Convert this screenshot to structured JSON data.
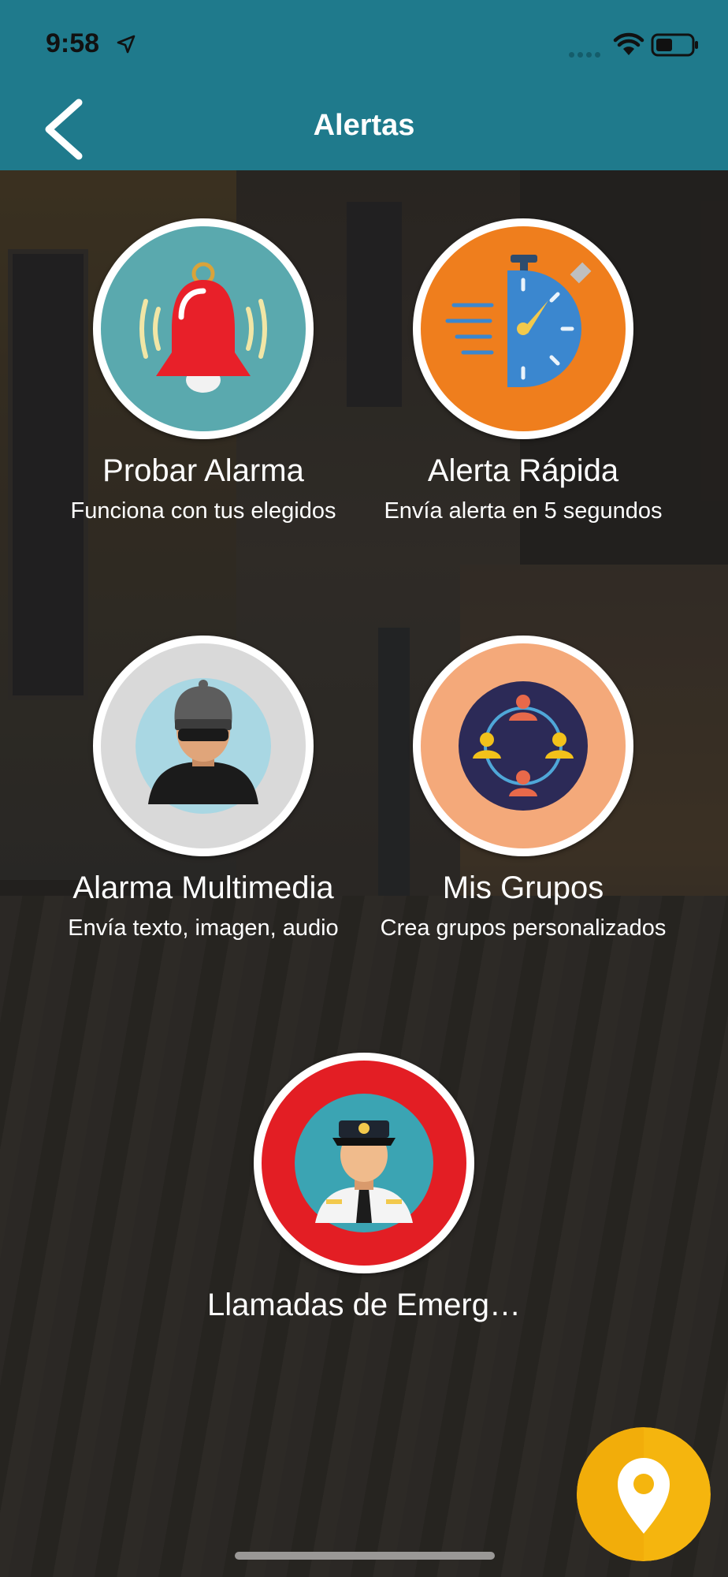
{
  "status_bar": {
    "time": "9:58"
  },
  "nav": {
    "title": "Alertas"
  },
  "tiles": [
    {
      "title": "Probar Alarma",
      "subtitle": "Funciona con tus elegidos",
      "icon": "bell-icon"
    },
    {
      "title": "Alerta Rápida",
      "subtitle": "Envía alerta en 5 segundos",
      "icon": "stopwatch-icon"
    },
    {
      "title": "Alarma Multimedia",
      "subtitle": "Envía texto, imagen, audio",
      "icon": "thief-icon"
    },
    {
      "title": "Mis Grupos",
      "subtitle": "Crea grupos personalizados",
      "icon": "group-network-icon"
    },
    {
      "title": "Llamadas de Emerg…",
      "subtitle": "",
      "icon": "police-officer-icon"
    }
  ],
  "fab": {
    "icon": "location-pin-icon"
  },
  "colors": {
    "header": "#1f7a8c",
    "bell_bg": "#5aa9ae",
    "bell": "#e82029",
    "stopwatch_bg": "#ef7e1d",
    "stopwatch": "#3b87cf",
    "thief_bg": "#d9d9d9",
    "groups_bg": "#f4a97a",
    "groups_inner": "#2c2a57",
    "police_ring": "#e31e24",
    "police_bg": "#3ba4b3",
    "fab": "#f5b50e"
  }
}
